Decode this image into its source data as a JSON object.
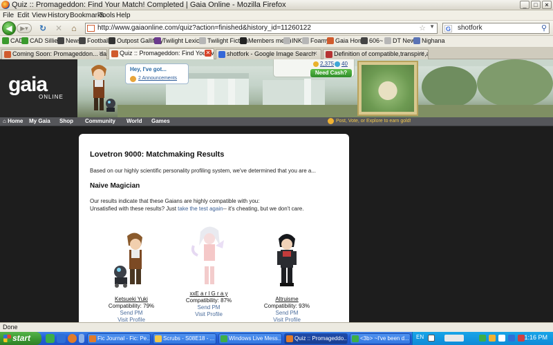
{
  "window": {
    "title": "Quiz :: Promageddon: Find Your Match! Completed | Gaia Online - Mozilla Firefox",
    "minimize": "_",
    "maximize": "□",
    "close": "×"
  },
  "menu": [
    "File",
    "Edit",
    "View",
    "History",
    "Bookmarks",
    "Tools",
    "Help"
  ],
  "navbar": {
    "url": "http://www.gaiaonline.com/quiz?action=finished&history_id=11260122",
    "search_engine": "G",
    "search_query": "shotfork"
  },
  "bookmarks": [
    {
      "label": "CAD",
      "color": "#3a9a2d"
    },
    {
      "label": "CAD Sillies!",
      "color": "#3a9a2d"
    },
    {
      "label": "News",
      "color": "#444444"
    },
    {
      "label": "Football",
      "color": "#444444"
    },
    {
      "label": "Outpost Gallifrey",
      "color": "#333333"
    },
    {
      "label": "Twilight Lexicon",
      "color": "#6b3a8e"
    },
    {
      "label": "Twilight Fiction",
      "color": "#b6b6b6"
    },
    {
      "label": "Members menu",
      "color": "#222222"
    },
    {
      "label": "INK",
      "color": "#b6b6b6"
    },
    {
      "label": "Foamy",
      "color": "#b6b6b6"
    },
    {
      "label": "Gaia Home",
      "color": "#d05b2d"
    },
    {
      "label": "606~",
      "color": "#444444"
    },
    {
      "label": "DT News",
      "color": "#b6b6b6"
    },
    {
      "label": "Nighana",
      "color": "#5a73b5"
    }
  ],
  "tabs": [
    {
      "label": "Coming Soon: Promageddon... dance li...",
      "icon_color": "#d05b2d",
      "active": false
    },
    {
      "label": "Quiz :: Promageddon: Find Your M...",
      "icon_color": "#d05b2d",
      "active": true
    },
    {
      "label": "shotfork - Google Image Search",
      "icon_color": "#3567d8",
      "active": false
    },
    {
      "label": "Definition of compatible,transpire,addle...",
      "icon_color": "#b63333",
      "active": false
    }
  ],
  "gaia": {
    "logo": "gaia",
    "logo_sub": "ONLINE",
    "bubble_title": "Hey, I've got...",
    "bubble_link": "2 Announcements",
    "gold": "2,375",
    "platinum": "40",
    "need_cash": "Need Cash?",
    "nav": [
      "Home",
      "My Gaia",
      "Shop",
      "Community",
      "World",
      "Games"
    ],
    "promo": "Post, Vote, or Explore to earn gold!"
  },
  "results": {
    "title": "Lovetron 9000: Matchmaking Results",
    "intro": "Based on our highly scientific personality profiling system, we've determined that you are a...",
    "personality": "Naive Magician",
    "compat_line": "Our results indicate that these Gaians are highly compatible with you:",
    "unsat_pre": "Unsatisfied with these results? Just ",
    "unsat_link": "take the test again",
    "unsat_post": "-- it's cheating, but we don't care.",
    "matches": [
      {
        "name": "Ketsueki Yuki",
        "compat": "Compatibility: 79%",
        "send": "Send PM",
        "visit": "Visit Profile"
      },
      {
        "name": "xxE a r l G r a y",
        "compat": "Compatibility: 87%",
        "send": "Send PM",
        "visit": "Visit Profile"
      },
      {
        "name": "Altruisme",
        "compat": "Compatibility: 93%",
        "send": "Send PM",
        "visit": "Visit Profile"
      }
    ]
  },
  "status": "Done",
  "taskbar": {
    "start": "start",
    "tasks": [
      {
        "label": "Fic Journal - Fic: Pe...",
        "icon_color": "#e07b2a",
        "active": false
      },
      {
        "label": "Scrubs - S08E18 - ...",
        "icon_color": "#f1c84b",
        "active": false
      },
      {
        "label": "Windows Live Mess...",
        "icon_color": "#3dae48",
        "active": false
      },
      {
        "label": "Quiz :: Promageddo...",
        "icon_color": "#e07b2a",
        "active": true
      },
      {
        "label": "<3b> ~I've been d...",
        "icon_color": "#3dae48",
        "active": false
      }
    ],
    "lang": "EN",
    "clock": "1:16 PM"
  }
}
